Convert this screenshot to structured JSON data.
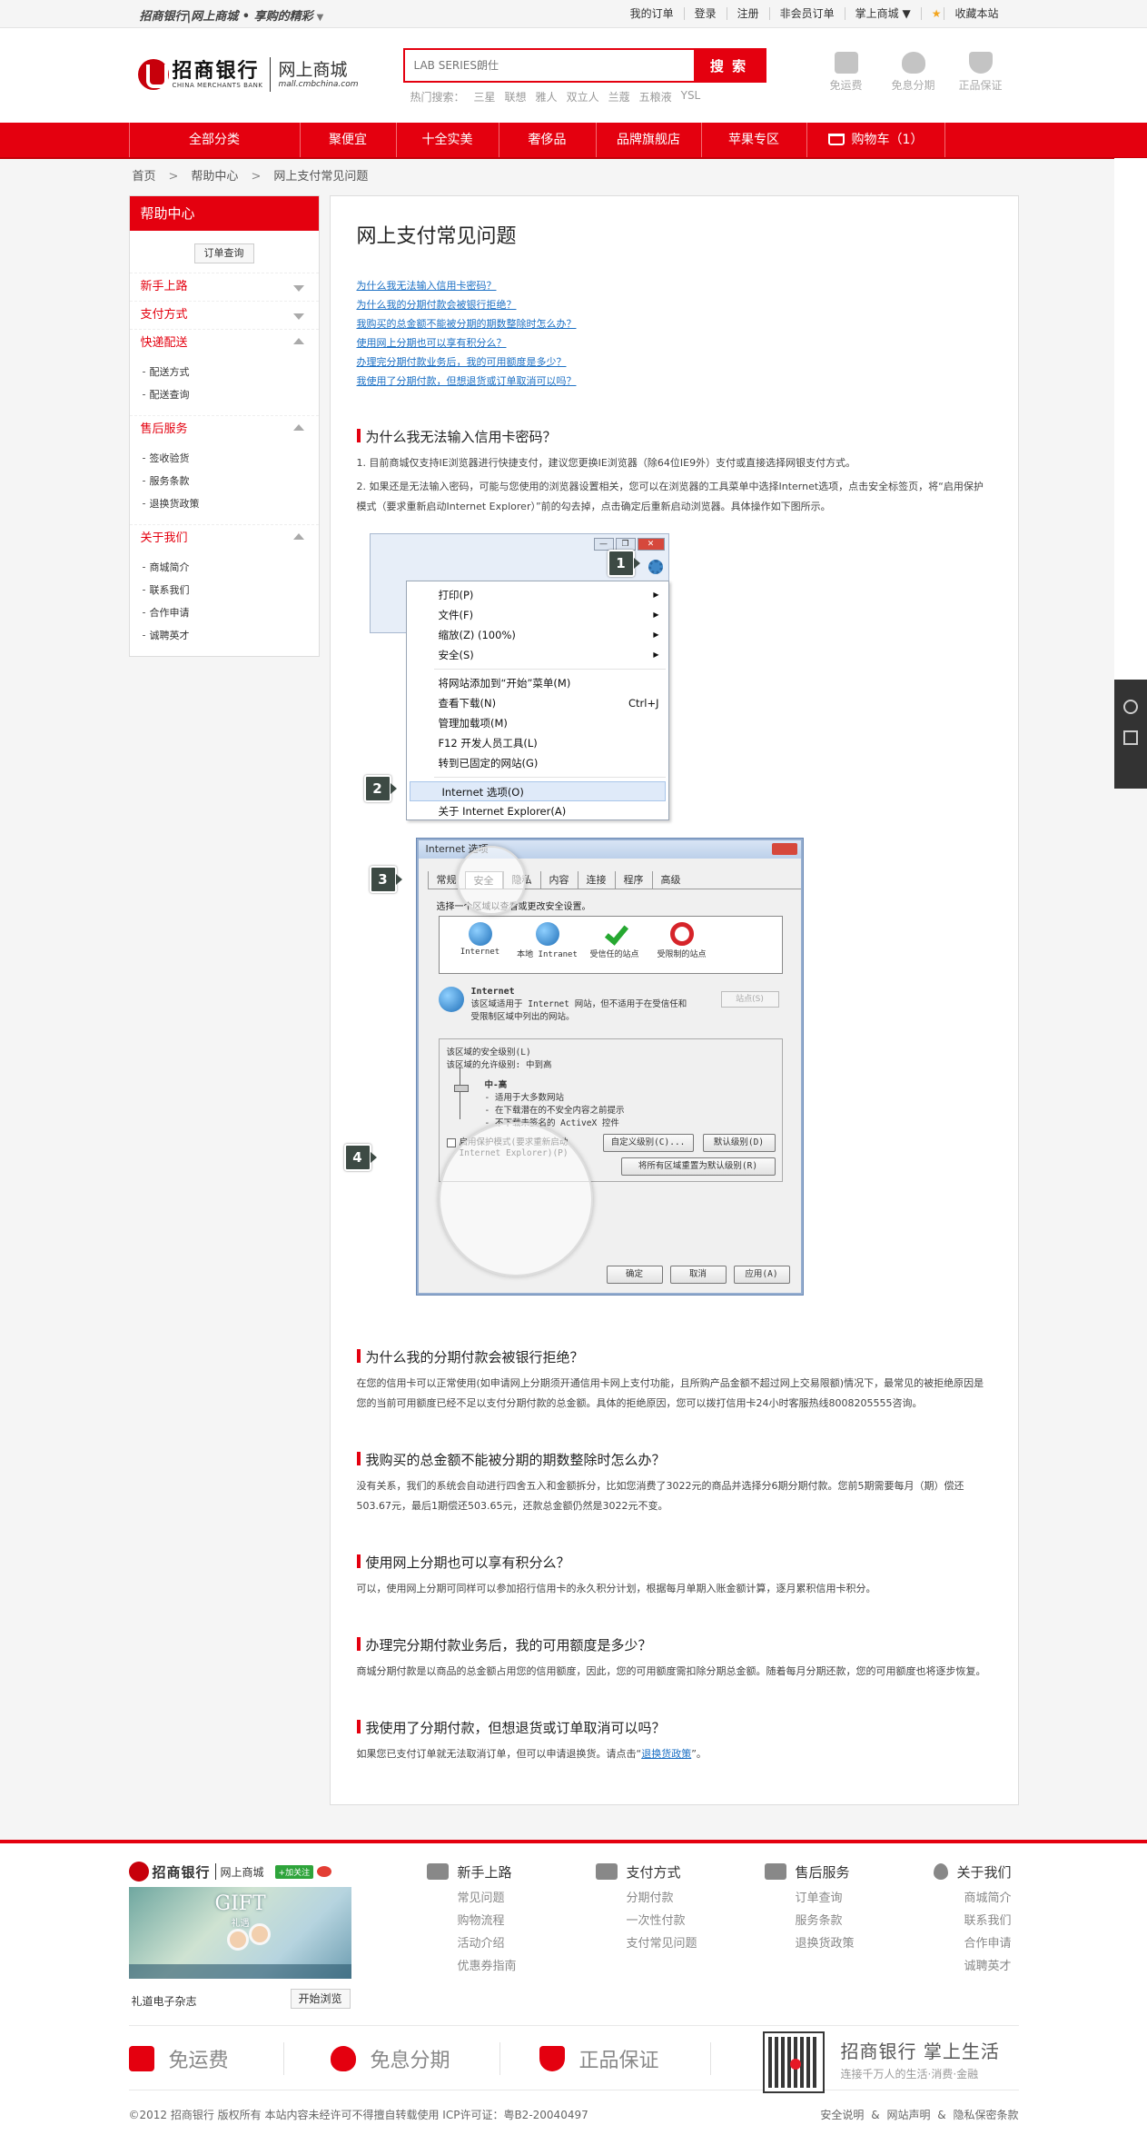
{
  "topbar": {
    "slogan": "招商银行|网上商城 • 享购的精彩",
    "slogan_caret": "▼",
    "links": [
      "我的订单",
      "登录",
      "注册",
      "非会员订单",
      "掌上商城 ▼",
      "收藏本站"
    ]
  },
  "header": {
    "logo_cn": "招商银行",
    "logo_en": "CHINA MERCHANTS BANK",
    "mall_name": "网上商城",
    "mall_url": "mall.cmbchina.com",
    "search_placeholder": "LAB SERIES朗仕",
    "search_button": "搜 索",
    "hot_label": "热门搜索：",
    "hot_terms": [
      "三星",
      "联想",
      "雅人",
      "双立人",
      "兰蔻",
      "五粮液",
      "YSL"
    ],
    "services": [
      "免运费",
      "免息分期",
      "正品保证"
    ]
  },
  "nav": {
    "items": [
      "全部分类",
      "聚便宜",
      "十全实美",
      "奢侈品",
      "品牌旗舰店",
      "苹果专区",
      "购物车（1）"
    ]
  },
  "breadcrumb": {
    "items": [
      "首页",
      "帮助中心",
      "网上支付常见问题"
    ],
    "sep": ">"
  },
  "sidebar": {
    "title": "帮助中心",
    "order_query": "订单查询",
    "sections": [
      {
        "title": "新手上路",
        "items": []
      },
      {
        "title": "支付方式",
        "items": []
      },
      {
        "title": "快递配送",
        "items": [
          "配送方式",
          "配送查询"
        ]
      },
      {
        "title": "售后服务",
        "items": [
          "签收验货",
          "服务条款",
          "退换货政策"
        ]
      },
      {
        "title": "关于我们",
        "items": [
          "商城简介",
          "联系我们",
          "合作申请",
          "诚聘英才"
        ]
      }
    ]
  },
  "main": {
    "title": "网上支付常见问题",
    "links": [
      "为什么我无法输入信用卡密码？",
      "为什么我的分期付款会被银行拒绝？",
      "我购买的总金额不能被分期的期数整除时怎么办？",
      "使用网上分期也可以享有积分么？",
      "办理完分期付款业务后，我的可用额度是多少？",
      "我使用了分期付款，但想退货或订单取消可以吗？"
    ],
    "q1": {
      "title": "为什么我无法输入信用卡密码？",
      "p1": "1. 目前商城仅支持IE浏览器进行快捷支付，建议您更换IE浏览器（除64位IE9外）支付或直接选择网银支付方式。",
      "p2": "2. 如果还是无法输入密码，可能与您使用的浏览器设置相关，您可以在浏览器的工具菜单中选择Internet选项，点击安全标签页，将“启用保护模式（要求重新启动Internet Explorer）”前的勾去掉，点击确定后重新启动浏览器。具体操作如下图所示。"
    },
    "ie_menu": {
      "items1": [
        "打印(P)",
        "文件(F)",
        "缩放(Z) (100%)",
        "安全(S)"
      ],
      "items2": [
        "将网站添加到“开始”菜单(M)",
        "查看下载(N)",
        "管理加载项(M)",
        "F12 开发人员工具(L)",
        "转到已固定的网站(G)"
      ],
      "download_shortcut": "Ctrl+J",
      "internet_options": "Internet 选项(O)",
      "about": "关于 Internet Explorer(A)",
      "window_buttons": [
        "—",
        "❐",
        "✕"
      ]
    },
    "ie_dialog": {
      "title": "Internet 选项",
      "tabs": [
        "常规",
        "安全",
        "隐私",
        "内容",
        "连接",
        "程序",
        "高级"
      ],
      "zone_prompt": "选择一个区域以查看或更改安全设置。",
      "zones": [
        "Internet",
        "本地 Intranet",
        "受信任的站点",
        "受限制的站点"
      ],
      "zone_title": "Internet",
      "zone_desc": "该区域适用于 Internet 网站，但不适用于在受信任和受限制区域中列出的网站。",
      "sites_button": "站点(S)",
      "level_title": "该区域的安全级别(L)",
      "allowed_levels": "该区域的允许级别: 中到高",
      "level_name": "中-高",
      "level_lines": [
        "- 适用于大多数网站",
        "- 在下载潜在的不安全内容之前提示",
        "- 不下载未签名的 ActiveX 控件"
      ],
      "protect_mode": "启用保护模式(要求重新启动 Internet Explorer)(P)",
      "custom_level": "自定义级别(C)...",
      "default_level": "默认级别(D)",
      "reset_all": "将所有区域重置为默认级别(R)",
      "ok": "确定",
      "cancel": "取消",
      "apply": "应用(A)"
    },
    "callouts": [
      "1",
      "2",
      "3",
      "4"
    ],
    "q2": {
      "title": "为什么我的分期付款会被银行拒绝？",
      "body": "在您的信用卡可以正常使用(如申请网上分期须开通信用卡网上支付功能，且所购产品金额不超过网上交易限额)情况下，最常见的被拒绝原因是您的当前可用额度已经不足以支付分期付款的总金额。具体的拒绝原因，您可以拨打信用卡24小时客服热线8008205555咨询。"
    },
    "q3": {
      "title": "我购买的总金额不能被分期的期数整除时怎么办？",
      "body": "没有关系，我们的系统会自动进行四舍五入和金额拆分，比如您消费了3022元的商品并选择分6期分期付款。您前5期需要每月（期）偿还503.67元，最后1期偿还503.65元，还款总金额仍然是3022元不变。"
    },
    "q4": {
      "title": "使用网上分期也可以享有积分么？",
      "body": "可以，使用网上分期可同样可以参加招行信用卡的永久积分计划，根据每月单期入账金额计算，逐月累积信用卡积分。"
    },
    "q5": {
      "title": "办理完分期付款业务后，我的可用额度是多少？",
      "body": "商城分期付款是以商品的总金额占用您的信用额度，因此，您的可用额度需扣除分期总金额。随着每月分期还款，您的可用额度也将逐步恢复。"
    },
    "q6": {
      "title": "我使用了分期付款，但想退货或订单取消可以吗？",
      "body_pre": "如果您已支付订单就无法取消订单，但可以申请退换货。请点击“",
      "link": "退换货政策",
      "body_post": "”。"
    }
  },
  "footer": {
    "logo_cn": "招商银行",
    "mall_name": "网上商城",
    "follow": "+加关注",
    "promo_title": "GIFT",
    "promo_sub": "礼遇",
    "magazine": "礼道电子杂志",
    "browse": "开始浏览",
    "cols": [
      {
        "title": "新手上路",
        "items": [
          "常见问题",
          "购物流程",
          "活动介绍",
          "优惠券指南"
        ]
      },
      {
        "title": "支付方式",
        "items": [
          "分期付款",
          "一次性付款",
          "支付常见问题"
        ]
      },
      {
        "title": "售后服务",
        "items": [
          "订单查询",
          "服务条款",
          "退换货政策"
        ]
      },
      {
        "title": "关于我们",
        "items": [
          "商城简介",
          "联系我们",
          "合作申请",
          "诚聘英才"
        ]
      }
    ],
    "guarantees": [
      "免运费",
      "免息分期",
      "正品保证"
    ],
    "app_title": "招商银行  掌上生活",
    "app_sub": "连接千万人的生活·消费·金融",
    "copyright": "©2012 招商银行 版权所有 本站内容未经许可不得擅自转载使用 ICP许可证：粤B2-20040497",
    "links": [
      "安全说明",
      "&",
      "网站声明",
      "&",
      "隐私保密条款"
    ]
  },
  "colors": {
    "brand_red": "#e4000f",
    "link_blue": "#1a6fc4"
  }
}
